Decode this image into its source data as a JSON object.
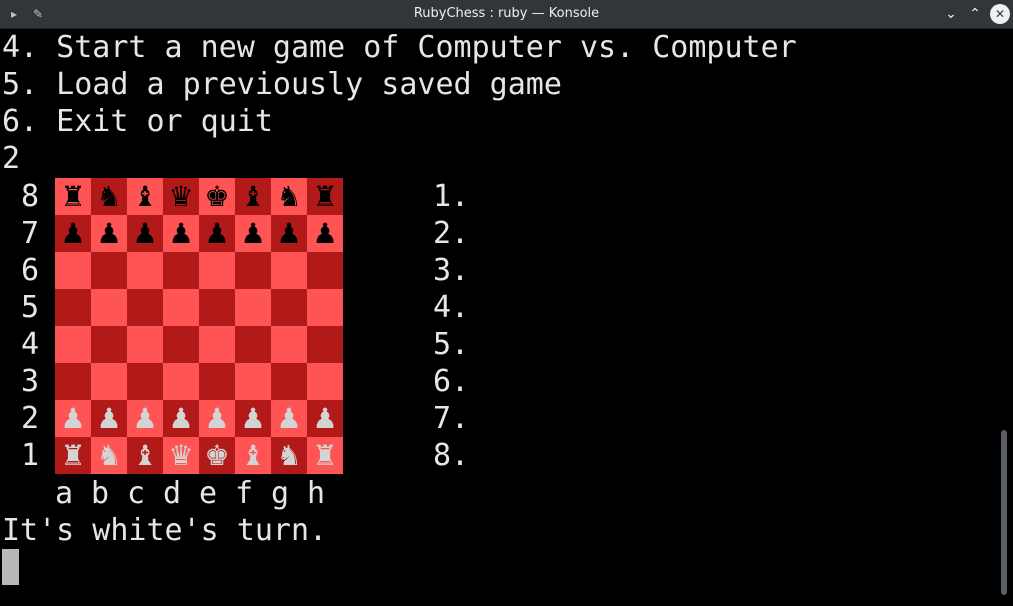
{
  "window": {
    "title": "RubyChess : ruby — Konsole",
    "left_icons": [
      "terminal-icon",
      "pin-icon"
    ],
    "buttons": [
      "chevron-down-icon",
      "chevron-up-icon",
      "close-icon"
    ]
  },
  "menu_lines": [
    "4. Start a new game of Computer vs. Computer",
    "5. Load a previously saved game",
    "6. Exit or quit",
    "2"
  ],
  "board": {
    "ranks": [
      "8",
      "7",
      "6",
      "5",
      "4",
      "3",
      "2",
      "1"
    ],
    "files": [
      "a",
      "b",
      "c",
      "d",
      "e",
      "f",
      "g",
      "h"
    ],
    "rows": [
      [
        "♜",
        "♞",
        "♝",
        "♛",
        "♚",
        "♝",
        "♞",
        "♜"
      ],
      [
        "♟",
        "♟",
        "♟",
        "♟",
        "♟",
        "♟",
        "♟",
        "♟"
      ],
      [
        "",
        "",
        "",
        "",
        "",
        "",
        "",
        ""
      ],
      [
        "",
        "",
        "",
        "",
        "",
        "",
        "",
        ""
      ],
      [
        "",
        "",
        "",
        "",
        "",
        "",
        "",
        ""
      ],
      [
        "",
        "",
        "",
        "",
        "",
        "",
        "",
        ""
      ],
      [
        "♟",
        "♟",
        "♟",
        "♟",
        "♟",
        "♟",
        "♟",
        "♟"
      ],
      [
        "♜",
        "♞",
        "♝",
        "♛",
        "♚",
        "♝",
        "♞",
        "♜"
      ]
    ],
    "colors": {
      "light_square": "#ff5454",
      "dark_square": "#b21a1a",
      "black_piece": "#000000",
      "white_piece": "#d4d4d4"
    }
  },
  "move_list": [
    "1.",
    "2.",
    "3.",
    "4.",
    "5.",
    "6.",
    "7.",
    "8."
  ],
  "status": "It's white's turn."
}
